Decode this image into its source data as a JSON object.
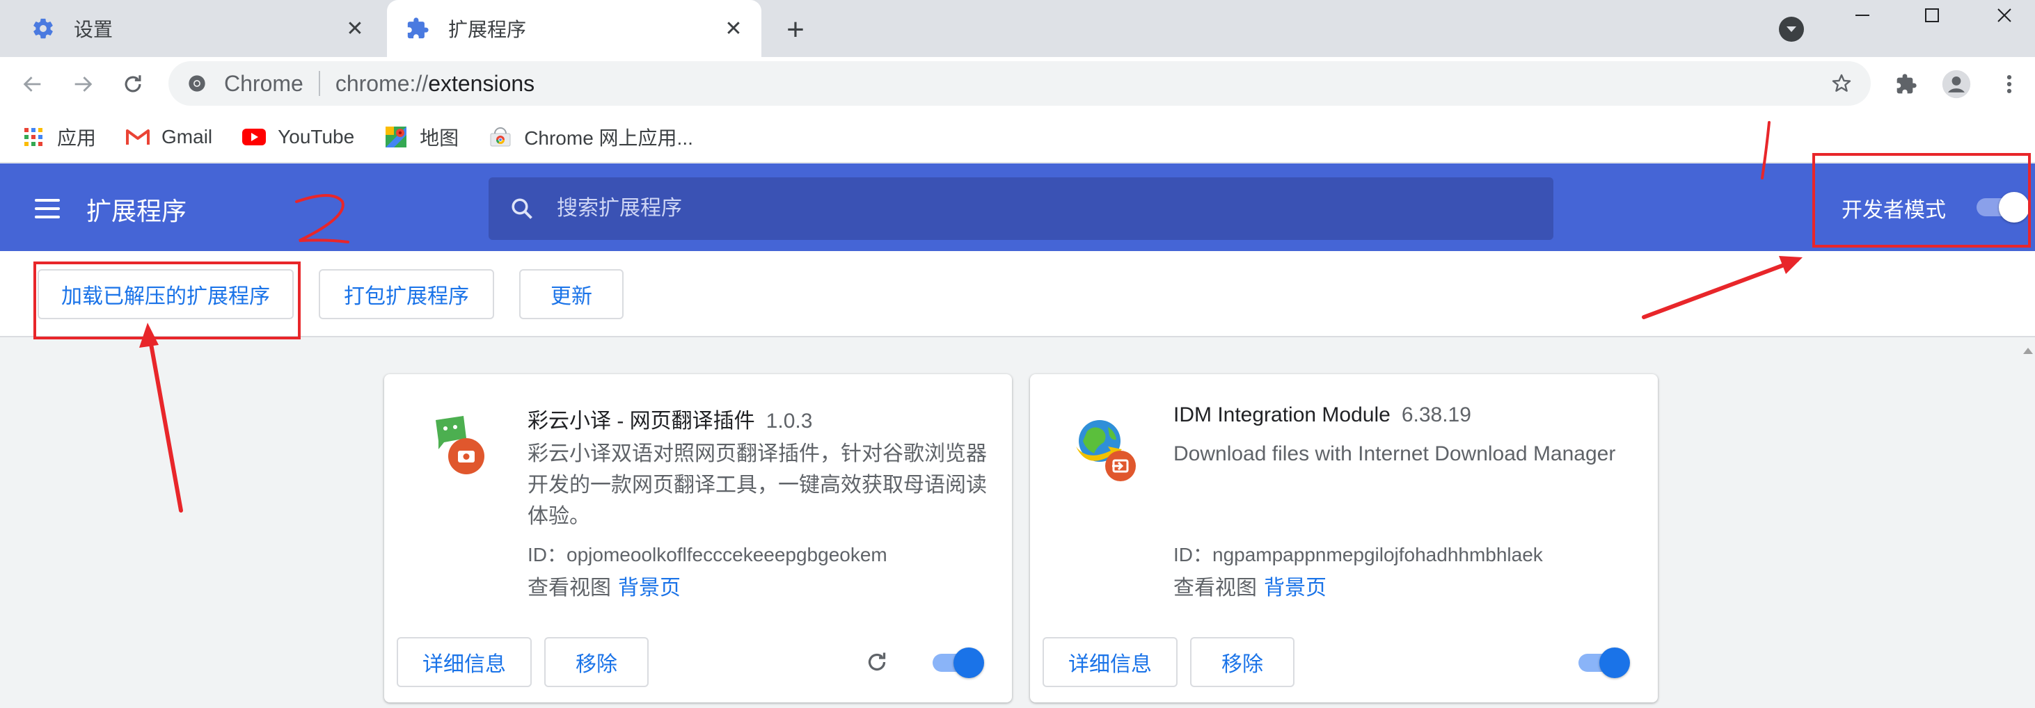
{
  "tabs": [
    {
      "title": "设置",
      "icon": "gear-icon",
      "active": false
    },
    {
      "title": "扩展程序",
      "icon": "puzzle-icon",
      "active": true
    }
  ],
  "toolbar": {
    "omnibox_site": "Chrome",
    "omnibox_scheme": "chrome://",
    "omnibox_path": "extensions"
  },
  "bookmarks": [
    {
      "label": "应用",
      "icon": "apps-grid-icon"
    },
    {
      "label": "Gmail",
      "icon": "gmail-icon"
    },
    {
      "label": "YouTube",
      "icon": "youtube-icon"
    },
    {
      "label": "地图",
      "icon": "maps-icon"
    },
    {
      "label": "Chrome 网上应用...",
      "icon": "chrome-webstore-icon"
    }
  ],
  "header": {
    "title": "扩展程序",
    "search_placeholder": "搜索扩展程序",
    "dev_mode_label": "开发者模式",
    "dev_mode_on": true
  },
  "actions": {
    "load_unpacked": "加载已解压的扩展程序",
    "pack": "打包扩展程序",
    "update": "更新"
  },
  "extensions": [
    {
      "name": "彩云小译 - 网页翻译插件",
      "version": "1.0.3",
      "description": "彩云小译双语对照网页翻译插件，针对谷歌浏览器开发的一款网页翻译工具，一键高效获取母语阅读体验。",
      "id_text": "ID：opjomeoolkoflfecccekeeepgbgeokem",
      "views_label": "查看视图",
      "views_link": "背景页",
      "details_label": "详细信息",
      "remove_label": "移除",
      "enabled": true,
      "has_reload": true
    },
    {
      "name": "IDM Integration Module",
      "version": "6.38.19",
      "description": "Download files with Internet Download Manager",
      "id_text": "ID：ngpampappnmepgilojfohadhhmbhlaek",
      "views_label": "查看视图",
      "views_link": "背景页",
      "details_label": "详细信息",
      "remove_label": "移除",
      "enabled": true,
      "has_reload": false
    }
  ],
  "annotations": {
    "mark_1": "1",
    "mark_2": "2",
    "color": "#e8262a"
  },
  "colors": {
    "header_bg": "#4565d6",
    "link_blue": "#1a73e8"
  }
}
